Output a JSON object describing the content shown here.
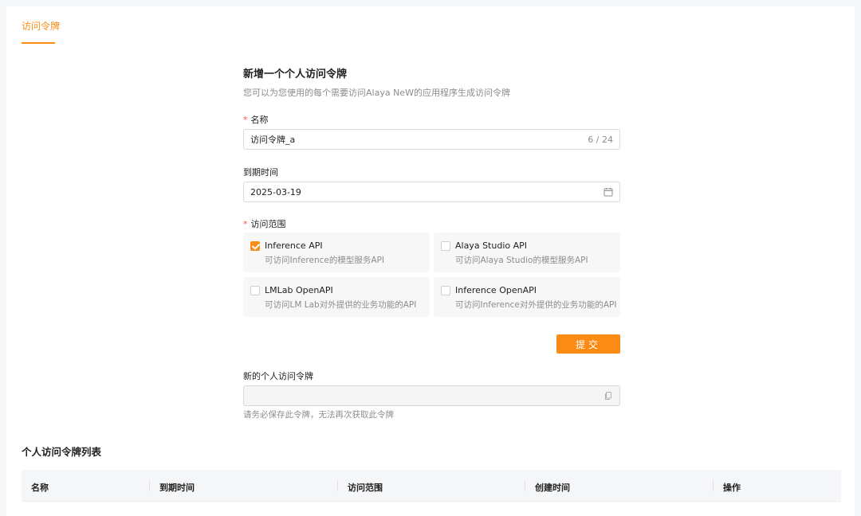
{
  "tabs": [
    {
      "label": "访问令牌",
      "active": true
    }
  ],
  "form": {
    "title": "新增一个个人访问令牌",
    "description": "您可以为您使用的每个需要访问Alaya NeW的应用程序生成访问令牌",
    "name": {
      "label": "名称",
      "required_mark": "*",
      "value": "访问令牌_a",
      "counter": "6 / 24"
    },
    "expiry": {
      "label": "到期时间",
      "value": "2025-03-19",
      "icon": "calendar-icon"
    },
    "scope": {
      "label": "访问范围",
      "required_mark": "*",
      "options": [
        {
          "title": "Inference API",
          "desc": "可访问Inference的模型服务API",
          "checked": true
        },
        {
          "title": "Alaya Studio API",
          "desc": "可访问Alaya Studio的模型服务API",
          "checked": false
        },
        {
          "title": "LMLab OpenAPI",
          "desc": "可访问LM Lab对外提供的业务功能的API",
          "checked": false
        },
        {
          "title": "Inference OpenAPI",
          "desc": "可访问Inference对外提供的业务功能的API",
          "checked": false
        }
      ]
    },
    "submit_label": "提交",
    "new_token": {
      "label": "新的个人访问令牌",
      "value": "",
      "icon": "copy-icon",
      "hint": "请务必保存此令牌，无法再次获取此令牌"
    }
  },
  "list": {
    "title": "个人访问令牌列表",
    "columns": [
      "名称",
      "到期时间",
      "访问范围",
      "创建时间",
      "操作"
    ]
  },
  "colors": {
    "accent": "#fa8c16",
    "required": "#ff4d4f",
    "muted_text": "#8c8c8c"
  }
}
